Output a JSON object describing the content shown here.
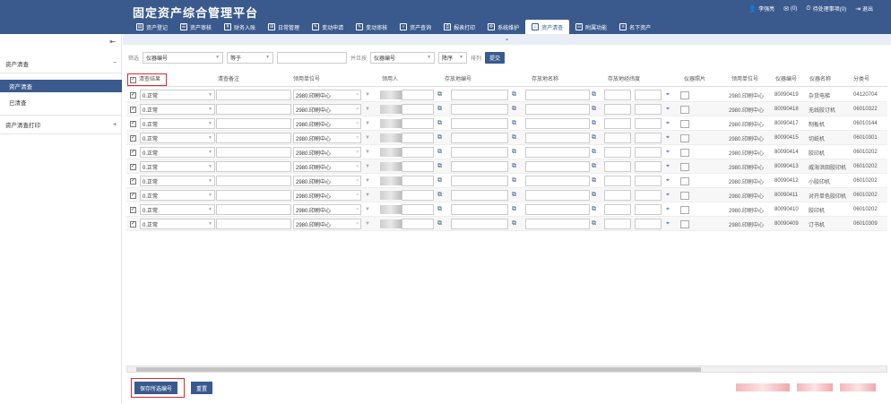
{
  "app": {
    "title": "固定资产综合管理平台"
  },
  "user_bar": [
    {
      "icon": "user-icon",
      "label": "李强亮"
    },
    {
      "icon": "mail-icon",
      "label": "(0)"
    },
    {
      "icon": "clock-icon",
      "label": "待处理事项(0)"
    },
    {
      "icon": "logout-icon",
      "label": "退出"
    }
  ],
  "nav": [
    {
      "label": "资产登记",
      "active": false
    },
    {
      "label": "资产审核",
      "active": false
    },
    {
      "label": "财务入账",
      "active": false
    },
    {
      "label": "日常管理",
      "active": false
    },
    {
      "label": "变动申请",
      "active": false
    },
    {
      "label": "变动审核",
      "active": false
    },
    {
      "label": "资产查询",
      "active": false
    },
    {
      "label": "报表打印",
      "active": false
    },
    {
      "label": "系统维护",
      "active": false
    },
    {
      "label": "资产清查",
      "active": true
    },
    {
      "label": "附属功能",
      "active": false
    },
    {
      "label": "名下资产",
      "active": false
    }
  ],
  "sidebar": {
    "groups": [
      {
        "label": "资产清查",
        "sign": "−"
      },
      {
        "label": "资产清查打印",
        "sign": "+"
      }
    ],
    "items": [
      {
        "label": "资产清查",
        "active": true
      },
      {
        "label": "已清查",
        "active": false
      }
    ]
  },
  "filter": {
    "label_filter": "筛选",
    "field": "仪器编号",
    "operator": "等于",
    "label_and": "并且按",
    "sort_field": "仪器编号",
    "sort_order": "降序",
    "label_sort": "排列",
    "submit": "提交"
  },
  "table": {
    "headers": [
      "清查结果",
      "清查备注",
      "领用单位号",
      "领用人",
      "存放地编号",
      "存放地名称",
      "存放地经纬度",
      "仪器照片",
      "领用单位号",
      "仪器编号",
      "仪器名称",
      "分类号"
    ],
    "rows": [
      {
        "result": "0.正常",
        "unit": "2980.印刷中心",
        "unit2": "2980.印刷中心",
        "code": "80090419",
        "name": "杂货电梯",
        "cls": "04120704"
      },
      {
        "result": "0.正常",
        "unit": "2980.印刷中心",
        "unit2": "2980.印刷中心",
        "code": "80090418",
        "name": "无线胶订机",
        "cls": "06010322"
      },
      {
        "result": "0.正常",
        "unit": "2980.印刷中心",
        "unit2": "2980.印刷中心",
        "code": "80090417",
        "name": "制板机",
        "cls": "06010144"
      },
      {
        "result": "0.正常",
        "unit": "2980.印刷中心",
        "unit2": "2980.印刷中心",
        "code": "80090415",
        "name": "切纸机",
        "cls": "06010301"
      },
      {
        "result": "0.正常",
        "unit": "2980.印刷中心",
        "unit2": "2980.印刷中心",
        "code": "80090414",
        "name": "胶印机",
        "cls": "06010202"
      },
      {
        "result": "0.正常",
        "unit": "2980.印刷中心",
        "unit2": "2980.印刷中心",
        "code": "80090413",
        "name": "威海洪田胶印机",
        "cls": "06010202"
      },
      {
        "result": "0.正常",
        "unit": "2980.印刷中心",
        "unit2": "2980.印刷中心",
        "code": "80090412",
        "name": "小胶印机",
        "cls": "06010202"
      },
      {
        "result": "0.正常",
        "unit": "2980.印刷中心",
        "unit2": "2980.印刷中心",
        "code": "80090411",
        "name": "对开单色胶印机",
        "cls": "06010202"
      },
      {
        "result": "0.正常",
        "unit": "2980.印刷中心",
        "unit2": "2980.印刷中心",
        "code": "80090410",
        "name": "胶印机",
        "cls": "06010202"
      },
      {
        "result": "0.正常",
        "unit": "2980.印刷中心",
        "unit2": "2980.印刷中心",
        "code": "80090409",
        "name": "订书机",
        "cls": "06010309"
      }
    ]
  },
  "footer": {
    "save": "保存所选编号",
    "reset": "重置"
  },
  "colors": {
    "primary": "#3a5a8e",
    "highlight": "#e0282e"
  }
}
